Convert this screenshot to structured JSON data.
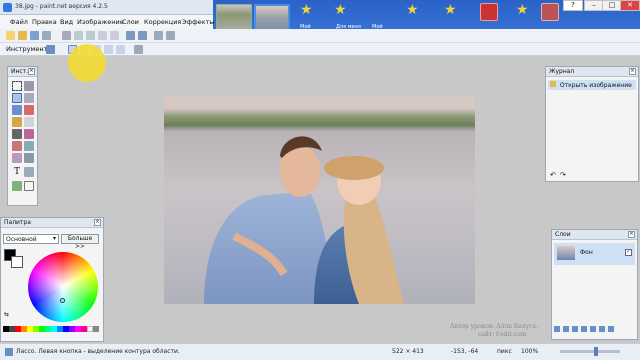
{
  "window": {
    "title": "38.jpg - paint.net версия 4.2.5"
  },
  "menu": {
    "items": [
      "Файл",
      "Правка",
      "Вид",
      "Изображение",
      "Слои",
      "Коррекция",
      "Эффекты"
    ]
  },
  "desktop": {
    "labels": [
      "Мой",
      "Для меня",
      "Мой"
    ]
  },
  "toolbar": {
    "tool_label": "Инструмент:"
  },
  "tools_panel": {
    "title": "Инст..."
  },
  "history_panel": {
    "title": "Журнал",
    "items": [
      {
        "label": "Открыть изображение"
      }
    ]
  },
  "layers_panel": {
    "title": "Слои",
    "layers": [
      {
        "name": "Фон",
        "visible": true
      }
    ]
  },
  "palette_panel": {
    "title": "Палитра",
    "mode_selected": "Основной",
    "more_button": "Больше >>",
    "primary_color": "#000000",
    "secondary_color": "#ffffff"
  },
  "statusbar": {
    "hint": "Лассо. Левая кнопка - выделение контура области.",
    "image_size": "522 × 413",
    "cursor_pos": "-153, -64",
    "units": "пикс",
    "zoom": "100%"
  },
  "watermark": {
    "line1": "Автор уроков: Алла Балуга.",
    "line2": "сайт: f-edit.com"
  },
  "colors": {
    "accent": "#4a90e2",
    "highlight": "#f5dc28",
    "panel_bg": "#f4f4f4"
  }
}
